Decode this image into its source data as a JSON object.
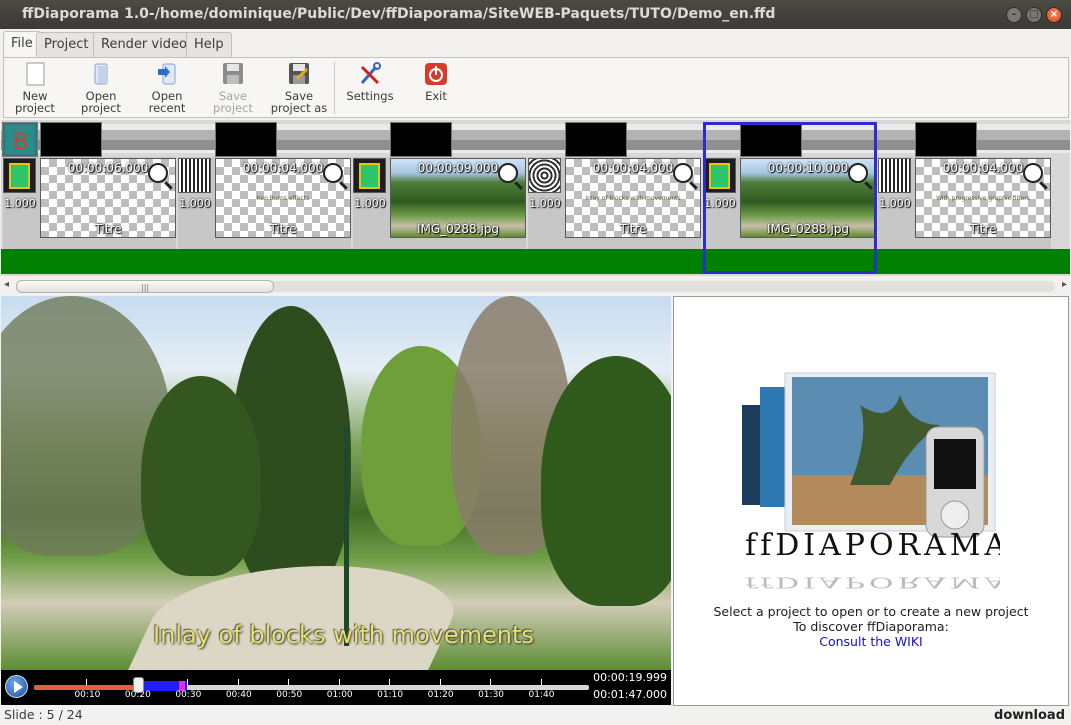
{
  "window": {
    "title": "ffDiaporama 1.0-/home/dominique/Public/Dev/ffDiaporama/SiteWEB-Paquets/TUTO/Demo_en.ffd",
    "controls": {
      "minimize": "-",
      "maximize": "□",
      "close": "×"
    }
  },
  "tabs": [
    {
      "label": "File",
      "active": true
    },
    {
      "label": "Project",
      "active": false
    },
    {
      "label": "Render video",
      "active": false
    },
    {
      "label": "Help",
      "active": false
    }
  ],
  "toolbar": {
    "new_project": "New\nproject",
    "open_project": "Open\nproject",
    "open_recent": "Open\nrecent",
    "save_project": "Save\nproject",
    "save_project_as": "Save\nproject as",
    "settings": "Settings",
    "exit": "Exit"
  },
  "timeline": {
    "slides": [
      {
        "duration": "00:00:06.000",
        "name": "Titre",
        "kind": "title",
        "transition_value": "1.000",
        "subtitle": ""
      },
      {
        "duration": "00:00:04.000",
        "name": "Titre",
        "kind": "title",
        "transition_value": "1.000",
        "subtitle": "Ken Burns effects"
      },
      {
        "duration": "00:00:09.000",
        "name": "IMG_0288.jpg",
        "kind": "photo",
        "transition_value": "1.000",
        "subtitle": ""
      },
      {
        "duration": "00:00:04.000",
        "name": "Titre",
        "kind": "title",
        "transition_value": "1.000",
        "subtitle": "Inlay of blocks with movements"
      },
      {
        "duration": "00:00:10.000",
        "name": "IMG_0288.jpg",
        "kind": "photo",
        "transition_value": "1.000",
        "subtitle": ""
      },
      {
        "duration": "00:00:04.000",
        "name": "Titre",
        "kind": "title",
        "transition_value": "1.000",
        "subtitle": "With progressive graphic filters"
      }
    ],
    "selected_index": 4
  },
  "preview": {
    "caption": "Inlay of blocks with movements",
    "current_time": "00:00:19.999",
    "total_time": "00:01:47.000",
    "ticks": [
      "00:10",
      "00:20",
      "00:30",
      "00:40",
      "00:50",
      "01:00",
      "01:10",
      "01:20",
      "01:30",
      "01:40"
    ],
    "progress_fraction": 0.187
  },
  "info": {
    "logo_text": "ffDiaporama",
    "line1": "Select a project to open or to create a new project",
    "line2": "To discover ffDiaporama:",
    "link": "Consult the WIKI"
  },
  "status": {
    "slide": "Slide : 5 / 24",
    "watermark": "download"
  },
  "colors": {
    "timeline_track": "#008000",
    "selection": "#2d2dcc",
    "caption": "#e7e268",
    "link": "#1111cc"
  }
}
